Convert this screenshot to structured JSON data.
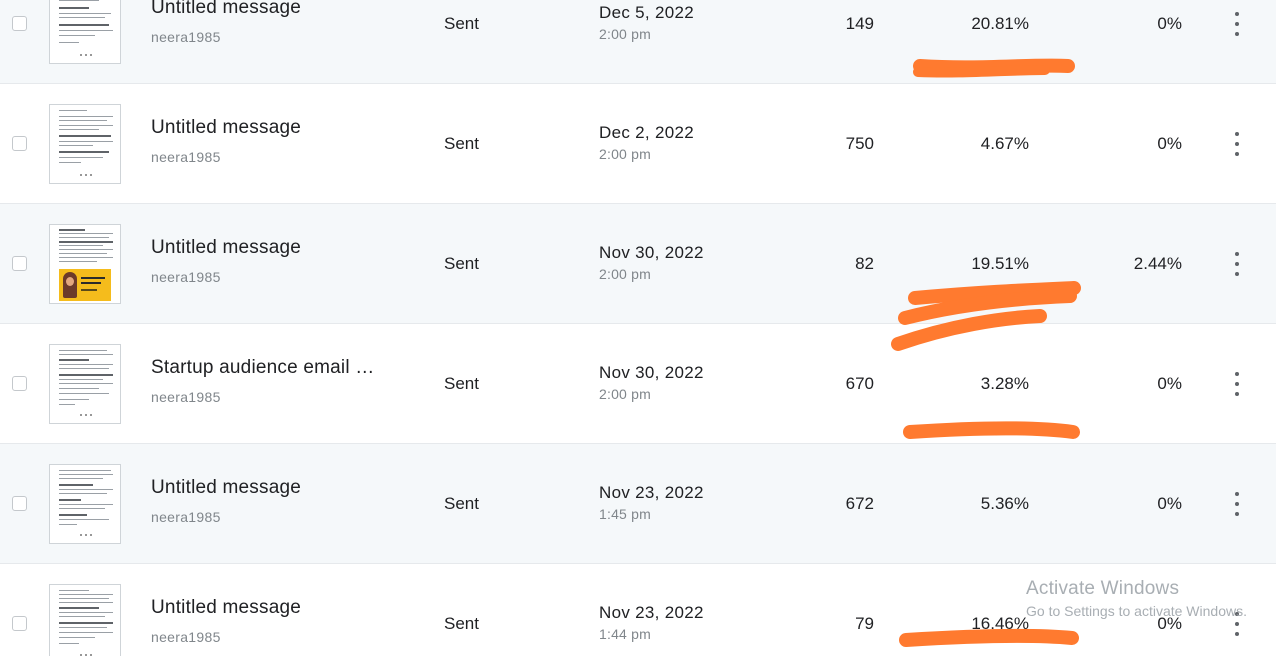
{
  "rows": [
    {
      "title": "Untitled message",
      "sender": "neera1985",
      "status": "Sent",
      "date": "Dec 5, 2022",
      "time": "2:00 pm",
      "recipients": "149",
      "open_rate": "20.81%",
      "click_rate": "0%",
      "thumbnail": "text-email-thumbnail"
    },
    {
      "title": "Untitled message",
      "sender": "neera1985",
      "status": "Sent",
      "date": "Dec 2, 2022",
      "time": "2:00 pm",
      "recipients": "750",
      "open_rate": "4.67%",
      "click_rate": "0%",
      "thumbnail": "text-email-thumbnail"
    },
    {
      "title": "Untitled message",
      "sender": "neera1985",
      "status": "Sent",
      "date": "Nov 30, 2022",
      "time": "2:00 pm",
      "recipients": "82",
      "open_rate": "19.51%",
      "click_rate": "2.44%",
      "thumbnail": "promo-email-thumbnail"
    },
    {
      "title": "Startup audience email …",
      "sender": "neera1985",
      "status": "Sent",
      "date": "Nov 30, 2022",
      "time": "2:00 pm",
      "recipients": "670",
      "open_rate": "3.28%",
      "click_rate": "0%",
      "thumbnail": "text-email-thumbnail"
    },
    {
      "title": "Untitled message",
      "sender": "neera1985",
      "status": "Sent",
      "date": "Nov 23, 2022",
      "time": "1:45 pm",
      "recipients": "672",
      "open_rate": "5.36%",
      "click_rate": "0%",
      "thumbnail": "text-email-thumbnail"
    },
    {
      "title": "Untitled message",
      "sender": "neera1985",
      "status": "Sent",
      "date": "Nov 23, 2022",
      "time": "1:44 pm",
      "recipients": "79",
      "open_rate": "16.46%",
      "click_rate": "0%",
      "thumbnail": "text-email-thumbnail"
    }
  ],
  "watermark": {
    "line1": "Activate Windows",
    "line2": "Go to Settings to activate Windows."
  },
  "colors": {
    "row_shaded": "#f5f8fa",
    "row_white": "#ffffff",
    "annotation_marker": "#ff7a2f",
    "secondary_text": "#80868b"
  }
}
